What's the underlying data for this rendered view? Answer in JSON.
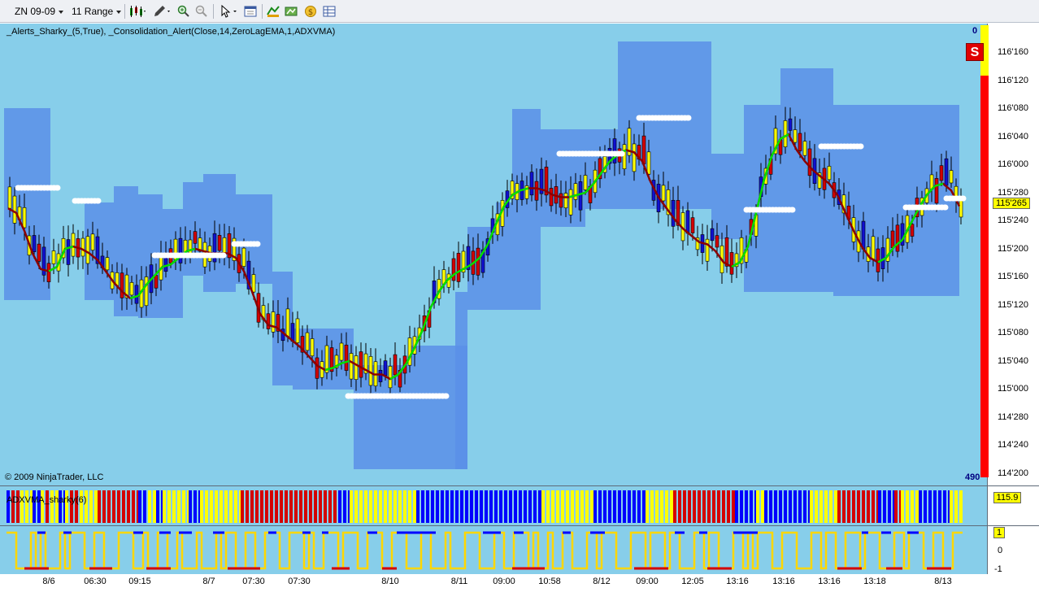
{
  "toolbar": {
    "instrument": "ZN 09-09",
    "period": "11 Range"
  },
  "indicator_line": "_Alerts_Sharky_(5,True), _Consolidation_Alert(Close,14,ZeroLagEMA,1,ADXVMA)",
  "copyright": "© 2009 NinjaTrader, LLC",
  "sub1_label": "ADXVMA_sharky(6)",
  "sub1_value": "115.9",
  "sub2_value": "1",
  "sub2_ticks": [
    "0",
    "-1"
  ],
  "top_counter": "0",
  "bottom_counter": "490",
  "signal_badge": "S",
  "current_price": "115'265",
  "price_ticks": [
    "116'160",
    "116'120",
    "116'080",
    "116'040",
    "116'000",
    "115'280",
    "115'240",
    "115'200",
    "115'160",
    "115'120",
    "115'080",
    "115'040",
    "115'000",
    "114'280",
    "114'240",
    "114'200"
  ],
  "x_ticks": [
    "8/6",
    "06:30",
    "09:15",
    "8/7",
    "07:30",
    "07:30",
    "8/10",
    "8/11",
    "09:00",
    "10:58",
    "8/12",
    "09:00",
    "12:05",
    "13:16",
    "13:16",
    "13:16",
    "13:18",
    "8/13"
  ],
  "colors": {
    "background": "#87ceea",
    "consolidation_box": "#5b8fe8",
    "bull_candle": "#ffff00",
    "bear_candle": "#d40000",
    "neutral_candle": "#1010d0",
    "fast_line": "#00e000",
    "slow_line": "#8b0000",
    "alert_marker": "#ffffff",
    "sub_up": "#ffd700",
    "sub_down": "#d40000",
    "sub_blue": "#0000ff"
  },
  "chart_data": {
    "type": "candlestick",
    "title": "",
    "y_ticks": [
      "116'160",
      "116'120",
      "116'080",
      "116'040",
      "116'000",
      "115'280",
      "115'240",
      "115'200",
      "115'160",
      "115'120",
      "115'080",
      "115'040",
      "115'000",
      "114'280",
      "114'240",
      "114'200"
    ],
    "x_ticks": [
      "8/6",
      "06:30",
      "09:15",
      "8/7",
      "07:30",
      "07:30",
      "8/10",
      "8/11",
      "09:00",
      "10:58",
      "8/12",
      "09:00",
      "12:05",
      "13:16",
      "13:16",
      "13:16",
      "13:18",
      "8/13"
    ],
    "close_path": [
      [
        10,
        115.72
      ],
      [
        20,
        115.7
      ],
      [
        30,
        115.62
      ],
      [
        40,
        115.52
      ],
      [
        50,
        115.45
      ],
      [
        60,
        115.44
      ],
      [
        70,
        115.46
      ],
      [
        80,
        115.54
      ],
      [
        90,
        115.55
      ],
      [
        100,
        115.54
      ],
      [
        110,
        115.52
      ],
      [
        120,
        115.49
      ],
      [
        130,
        115.44
      ],
      [
        140,
        115.39
      ],
      [
        150,
        115.35
      ],
      [
        160,
        115.32
      ],
      [
        170,
        115.33
      ],
      [
        180,
        115.38
      ],
      [
        190,
        115.42
      ],
      [
        200,
        115.46
      ],
      [
        210,
        115.47
      ],
      [
        220,
        115.5
      ],
      [
        230,
        115.53
      ],
      [
        240,
        115.54
      ],
      [
        250,
        115.53
      ],
      [
        260,
        115.52
      ],
      [
        270,
        115.52
      ],
      [
        280,
        115.52
      ],
      [
        290,
        115.5
      ],
      [
        300,
        115.44
      ],
      [
        310,
        115.35
      ],
      [
        320,
        115.25
      ],
      [
        330,
        115.2
      ],
      [
        340,
        115.19
      ],
      [
        350,
        115.16
      ],
      [
        360,
        115.13
      ],
      [
        370,
        115.1
      ],
      [
        380,
        115.06
      ],
      [
        390,
        115.02
      ],
      [
        400,
        115.0
      ],
      [
        410,
        115.01
      ],
      [
        420,
        115.03
      ],
      [
        430,
        115.04
      ],
      [
        440,
        115.02
      ],
      [
        450,
        115.0
      ],
      [
        460,
        114.98
      ],
      [
        470,
        114.98
      ],
      [
        480,
        114.96
      ],
      [
        490,
        114.98
      ],
      [
        500,
        115.03
      ],
      [
        510,
        115.1
      ],
      [
        520,
        115.18
      ],
      [
        530,
        115.28
      ],
      [
        540,
        115.35
      ],
      [
        550,
        115.4
      ],
      [
        560,
        115.43
      ],
      [
        570,
        115.45
      ],
      [
        580,
        115.47
      ],
      [
        590,
        115.5
      ],
      [
        600,
        115.56
      ],
      [
        610,
        115.65
      ],
      [
        620,
        115.73
      ],
      [
        630,
        115.78
      ],
      [
        640,
        115.8
      ],
      [
        650,
        115.81
      ],
      [
        660,
        115.81
      ],
      [
        670,
        115.8
      ],
      [
        680,
        115.78
      ],
      [
        690,
        115.77
      ],
      [
        700,
        115.77
      ],
      [
        710,
        115.78
      ],
      [
        720,
        115.79
      ],
      [
        730,
        115.83
      ],
      [
        740,
        115.88
      ],
      [
        750,
        115.93
      ],
      [
        760,
        115.96
      ],
      [
        770,
        115.98
      ],
      [
        780,
        115.97
      ],
      [
        790,
        115.93
      ],
      [
        800,
        115.84
      ],
      [
        810,
        115.77
      ],
      [
        820,
        115.72
      ],
      [
        830,
        115.67
      ],
      [
        840,
        115.63
      ],
      [
        850,
        115.6
      ],
      [
        860,
        115.57
      ],
      [
        870,
        115.56
      ],
      [
        880,
        115.53
      ],
      [
        890,
        115.48
      ],
      [
        900,
        115.46
      ],
      [
        910,
        115.48
      ],
      [
        920,
        115.55
      ],
      [
        930,
        115.7
      ],
      [
        940,
        115.85
      ],
      [
        950,
        115.96
      ],
      [
        960,
        116.03
      ],
      [
        970,
        116.05
      ],
      [
        980,
        115.98
      ],
      [
        990,
        115.93
      ],
      [
        1000,
        115.89
      ],
      [
        1010,
        115.86
      ],
      [
        1020,
        115.83
      ],
      [
        1030,
        115.78
      ],
      [
        1040,
        115.7
      ],
      [
        1050,
        115.62
      ],
      [
        1060,
        115.55
      ],
      [
        1070,
        115.5
      ],
      [
        1080,
        115.48
      ],
      [
        1090,
        115.5
      ],
      [
        1100,
        115.55
      ],
      [
        1110,
        115.58
      ],
      [
        1120,
        115.65
      ],
      [
        1130,
        115.72
      ],
      [
        1140,
        115.78
      ],
      [
        1150,
        115.82
      ],
      [
        1160,
        115.83
      ],
      [
        1170,
        115.8
      ],
      [
        1180,
        115.73
      ]
    ]
  }
}
